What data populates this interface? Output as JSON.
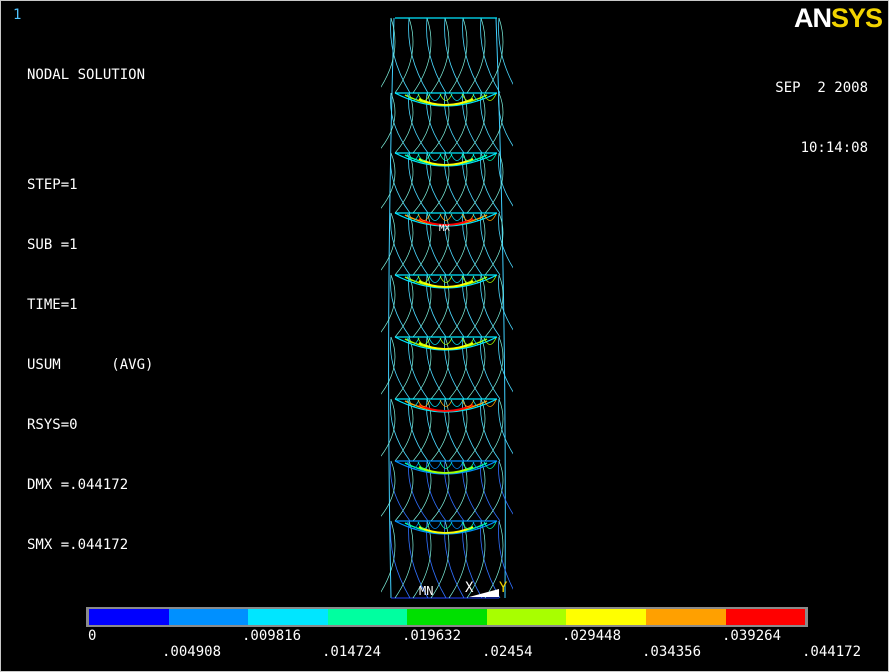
{
  "window_number": "1",
  "logo": {
    "an": "AN",
    "sys": "SYS"
  },
  "info": {
    "title": "NODAL SOLUTION",
    "step": "STEP=1",
    "sub": "SUB =1",
    "time": "TIME=1",
    "usum": "USUM      (AVG)",
    "rsys": "RSYS=0",
    "dmx": "DMX =.044172",
    "smx": "SMX =.044172"
  },
  "date": "SEP  2 2008",
  "time_of_day": "10:14:08",
  "model_labels": {
    "mn": "MN",
    "mx": "MX",
    "x": "X",
    "y": "Y"
  },
  "legend": {
    "colors": [
      "#0000ff",
      "#0090ff",
      "#00e6ff",
      "#00ffa0",
      "#00e000",
      "#a8ff00",
      "#ffff00",
      "#ffa000",
      "#ff0000"
    ],
    "top_labels": [
      "0",
      ".009816",
      ".019632",
      ".029448",
      ".039264"
    ],
    "bottom_labels": [
      ".004908",
      ".014724",
      ".02454",
      ".034356",
      ".044172"
    ]
  }
}
